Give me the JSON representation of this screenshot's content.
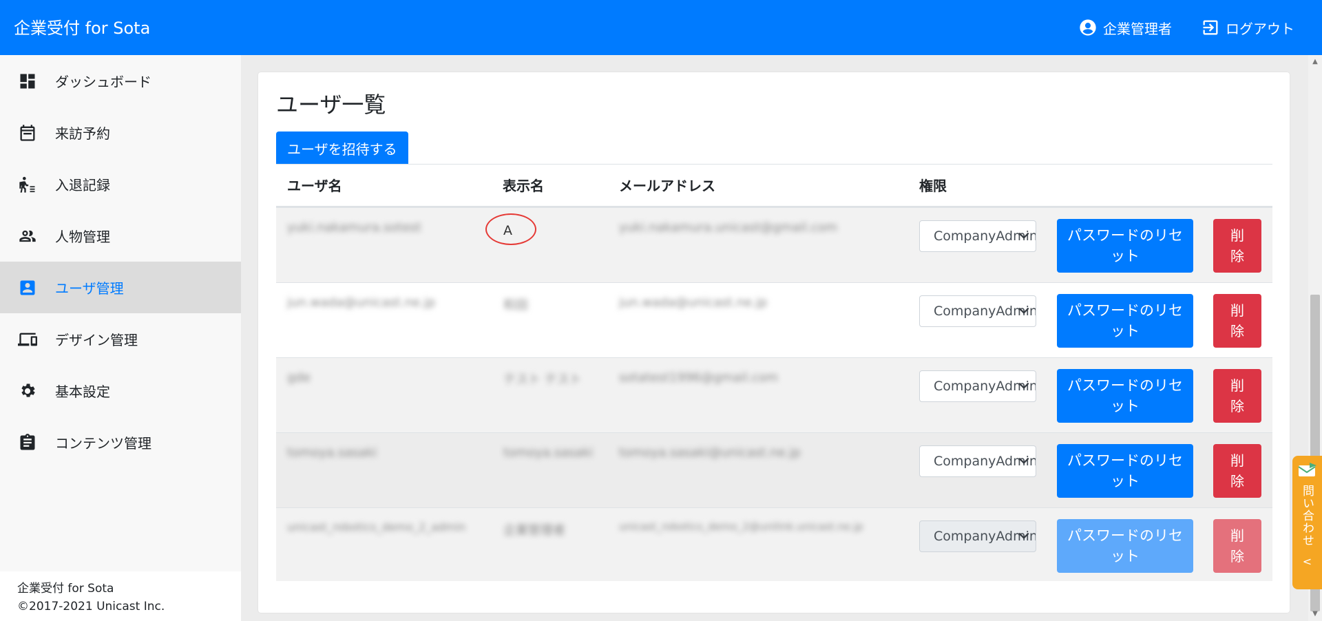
{
  "header": {
    "brand": "企業受付 for Sota",
    "user_label": "企業管理者",
    "logout_label": "ログアウト"
  },
  "sidebar": {
    "items": [
      {
        "label": "ダッシュボード",
        "icon": "dashboard-icon"
      },
      {
        "label": "来訪予約",
        "icon": "calendar-icon"
      },
      {
        "label": "入退記録",
        "icon": "walking-person-icon"
      },
      {
        "label": "人物管理",
        "icon": "people-icon"
      },
      {
        "label": "ユーザ管理",
        "icon": "user-badge-icon",
        "active": true
      },
      {
        "label": "デザイン管理",
        "icon": "devices-icon"
      },
      {
        "label": "基本設定",
        "icon": "gear-icon"
      },
      {
        "label": "コンテンツ管理",
        "icon": "clipboard-icon"
      }
    ],
    "footer": {
      "line1": "企業受付 for Sota",
      "line2": "©2017-2021 Unicast Inc."
    }
  },
  "main": {
    "title": "ユーザ一覧",
    "invite_label": "ユーザを招待する",
    "columns": [
      "ユーザ名",
      "表示名",
      "メールアドレス",
      "権限"
    ],
    "rows": [
      {
        "username": "yuki.nakamura.sotest",
        "display": "A",
        "email": "yuki.nakamura.unicast@gmail.com",
        "role": "CompanyAdmin",
        "disabled": false,
        "highlight": true
      },
      {
        "username": "jun.wada@unicast.ne.jp",
        "display": "和田",
        "email": "jun.wada@unicast.ne.jp",
        "role": "CompanyAdmin",
        "disabled": false
      },
      {
        "username": "gde",
        "display": "テスト テスト",
        "email": "sotatest1996@gmail.com",
        "role": "CompanyAdmin",
        "disabled": false
      },
      {
        "username": "tomoya.sasaki",
        "display": "tomoya.sasaki",
        "email": "tomoya.sasaki@unicast.ne.jp",
        "role": "CompanyAdmin",
        "disabled": false
      },
      {
        "username": "unicast_robotics_demo_2_admin",
        "display": "企業管理者",
        "email": "unicast_robotics_demo_2@unilink.unicast.ne.jp",
        "role": "CompanyAdmin",
        "disabled": true
      }
    ],
    "reset_label": "パスワードのリセット",
    "delete_label": "削除"
  },
  "widget": {
    "contact_label": "問い合わせ",
    "collapse_glyph": "<"
  },
  "colors": {
    "primary": "#007bff",
    "danger": "#dc3545",
    "widget": "#f5a623"
  }
}
